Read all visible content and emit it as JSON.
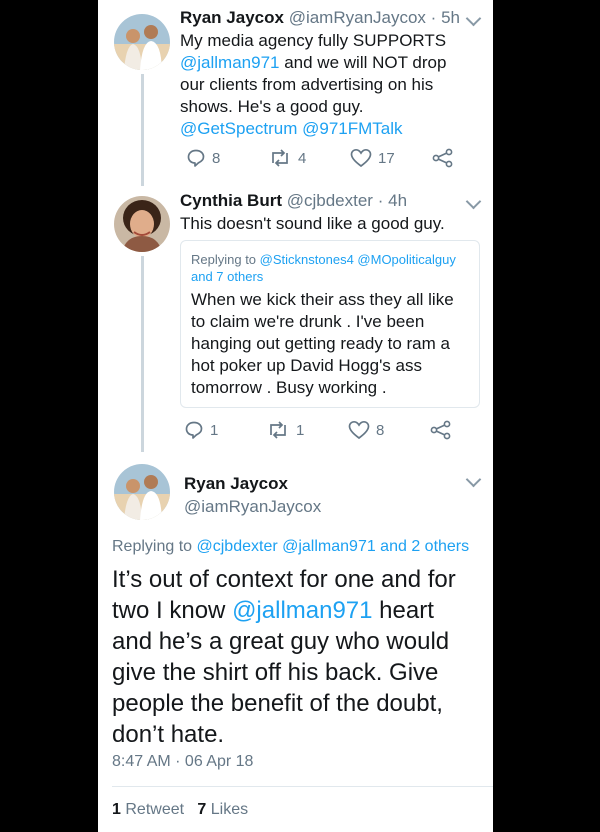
{
  "tweet1": {
    "name": "Ryan Jaycox",
    "handle": "@iamRyanJaycox",
    "sep": "·",
    "time": "5h",
    "text_a": "My media agency fully SUPPORTS",
    "link_jallman": "@jallman971",
    "text_b": "and we will NOT drop our clients from advertising on his shows. He's a good guy.",
    "link_spectrum": "@GetSpectrum",
    "link_971": "@971FMTalk",
    "replies": "8",
    "retweets": "4",
    "likes": "17"
  },
  "tweet2": {
    "name": "Cynthia Burt",
    "handle": "@cjbdexter",
    "sep": "·",
    "time": "4h",
    "text": "This doesn't sound like a good guy.",
    "quote": {
      "replying_prefix": "Replying to",
      "replying_targets": "@Sticknstones4 @MOpoliticalguy and 7 others",
      "text": "When we kick their ass they all like to claim we're drunk . I've been hanging out getting ready to ram a hot poker up David Hogg's ass tomorrow . Busy working ."
    },
    "replies": "1",
    "retweets": "1",
    "likes": "8"
  },
  "tweet3": {
    "name": "Ryan Jaycox",
    "handle": "@iamRyanJaycox",
    "replying_prefix": "Replying to",
    "replying_targets": "@cjbdexter @jallman971 and 2 others",
    "text_a": "It’s out of context for one and for two I know",
    "link_jallman": "@jallman971",
    "text_b": "heart and he’s a great guy who would give the shirt off his back. Give people the benefit of the doubt, don’t hate.",
    "timestamp": "8:47 AM · 06 Apr 18",
    "retweet_count": "1",
    "retweet_label": "Retweet",
    "like_count": "7",
    "like_label": "Likes"
  },
  "colors": {
    "link": "#1da1f2",
    "muted": "#657786",
    "text": "#14171a",
    "divider": "#e1e8ed"
  },
  "icons": [
    "reply-icon",
    "retweet-icon",
    "like-icon",
    "share-icon",
    "chevron-down-icon"
  ]
}
